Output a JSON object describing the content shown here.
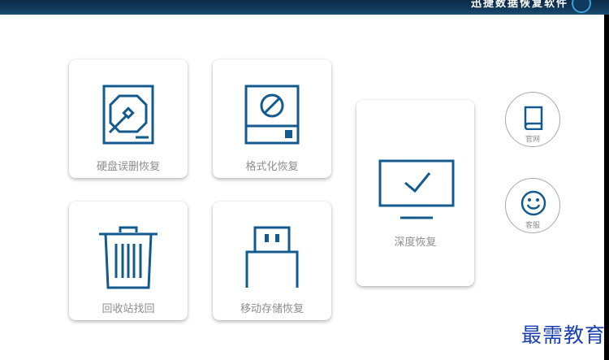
{
  "header": {
    "title": "迅捷数据恢复软件"
  },
  "tiles": {
    "disk": {
      "label": "硬盘误删恢复",
      "icon": "hard-disk-icon"
    },
    "format": {
      "label": "格式化恢复",
      "icon": "format-disk-icon"
    },
    "recycle": {
      "label": "回收站找回",
      "icon": "recycle-bin-icon"
    },
    "usb": {
      "label": "移动存储恢复",
      "icon": "usb-drive-icon"
    },
    "deep": {
      "label": "深度恢复",
      "icon": "monitor-check-icon"
    }
  },
  "side": {
    "website": {
      "label": "官网",
      "icon": "book-icon"
    },
    "service": {
      "label": "客服",
      "icon": "smiley-icon"
    }
  },
  "watermark": "最需教育",
  "colors": {
    "accent": "#135b8e",
    "label": "#8d8d8d",
    "watermark": "#1a3fb0"
  }
}
